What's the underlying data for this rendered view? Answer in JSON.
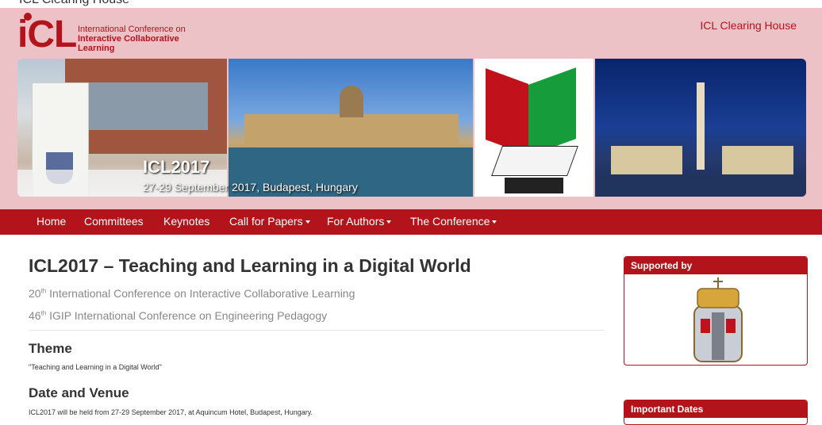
{
  "window_title": "ICL Clearing House",
  "logo": {
    "acronym": "iCL",
    "line1": "International Conference on",
    "line2": "Interactive Collaborative",
    "line3": "Learning"
  },
  "header_link": "ICL Clearing House",
  "banner": {
    "title": "ICL2017",
    "subtitle": "27-29 September 2017, Budapest, Hungary"
  },
  "nav": [
    {
      "label": "Home",
      "dropdown": false
    },
    {
      "label": "Committees",
      "dropdown": false
    },
    {
      "label": "Keynotes",
      "dropdown": false
    },
    {
      "label": "Call for Papers",
      "dropdown": true
    },
    {
      "label": "For Authors",
      "dropdown": true
    },
    {
      "label": "The Conference",
      "dropdown": true
    }
  ],
  "main": {
    "title": "ICL2017 – Teaching and Learning in a Digital World",
    "sub1_num": "20",
    "sub1_sup": "th",
    "sub1_text": " International Conference on Interactive Collaborative Learning",
    "sub2_num": "46",
    "sub2_sup": "th",
    "sub2_text": " IGIP International Conference on Engineering Pedagogy",
    "theme_heading": "Theme",
    "theme_text": "\"Teaching and Learning in a Digital World\"",
    "venue_heading": "Date and Venue",
    "venue_text": "ICL2017 will be held from 27-29 September 2017, at Aquincum Hotel, Budapest, Hungary."
  },
  "sidebar": {
    "supported_by": "Supported by",
    "important_dates": "Important Dates"
  },
  "colors": {
    "brand_red": "#b3141b",
    "header_pink": "#ecc2c6"
  }
}
